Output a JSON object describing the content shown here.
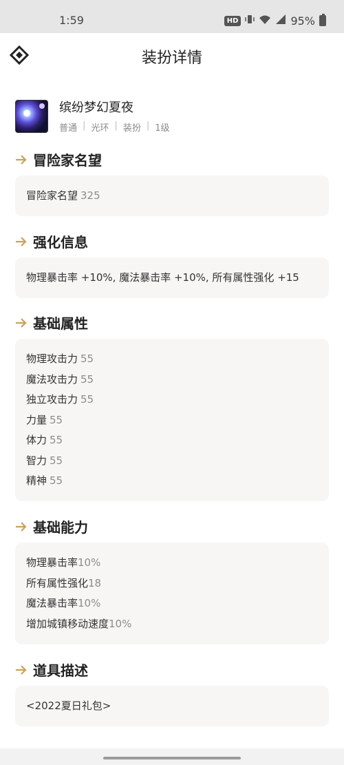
{
  "status": {
    "time": "1:59",
    "hd": "HD",
    "battery": "95%"
  },
  "header": {
    "title": "装扮详情",
    "logo_icon": "diamond-logo-icon"
  },
  "item": {
    "name": "缤纷梦幻夏夜",
    "tags": [
      "普通",
      "光环",
      "装扮",
      "1级"
    ]
  },
  "sections": {
    "fame": {
      "title": "冒险家名望",
      "rows": [
        {
          "label": "冒险家名望",
          "value": "325"
        }
      ]
    },
    "enhance": {
      "title": "强化信息",
      "text": "物理暴击率 +10%, 魔法暴击率 +10%, 所有属性强化 +15"
    },
    "base_attr": {
      "title": "基础属性",
      "rows": [
        {
          "label": "物理攻击力",
          "value": "55"
        },
        {
          "label": "魔法攻击力",
          "value": "55"
        },
        {
          "label": "独立攻击力",
          "value": "55"
        },
        {
          "label": "力量",
          "value": "55"
        },
        {
          "label": "体力",
          "value": "55"
        },
        {
          "label": "智力",
          "value": "55"
        },
        {
          "label": "精神",
          "value": "55"
        }
      ]
    },
    "base_ability": {
      "title": "基础能力",
      "rows": [
        {
          "label": "物理暴击率",
          "value": "10%"
        },
        {
          "label": "所有属性强化",
          "value": "18"
        },
        {
          "label": "魔法暴击率",
          "value": "10%"
        },
        {
          "label": "增加城镇移动速度",
          "value": "10%"
        }
      ]
    },
    "desc": {
      "title": "道具描述",
      "text": "<2022夏日礼包>"
    }
  },
  "colors": {
    "accent": "#c9a25a",
    "card_bg": "#f7f6f4",
    "value_gray": "#8c8c8c"
  }
}
